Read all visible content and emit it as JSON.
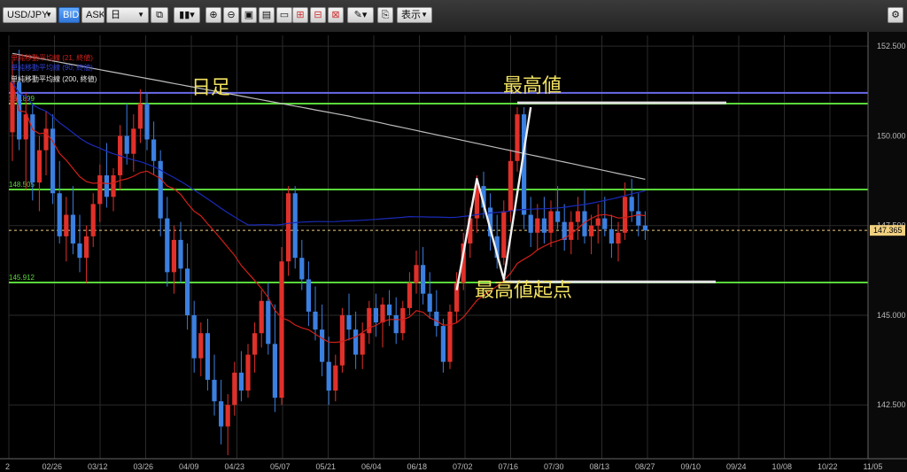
{
  "toolbar": {
    "symbol": "USD/JPY",
    "bid_label": "BID",
    "ask_label": "ASK",
    "timeframe": "日",
    "display_label": "表示"
  },
  "legend": {
    "ma21": "単純移動平均線 (21, 終値)",
    "ma90": "単純移動平均線 (90, 終値)",
    "ma200": "単純移動平均線 (200, 終値)"
  },
  "annotations": {
    "timeframe_note": "日足",
    "high_label": "最高値",
    "high_start_label": "最高値起点"
  },
  "colors": {
    "up": "#e0302a",
    "down": "#3b7fe0",
    "ma21": "#d0201a",
    "ma90": "#1a2ab8",
    "ma200": "#bdbdbd",
    "support": "#5ad83a",
    "resistance_blue": "#6a6ae8",
    "annotation_text": "#f0e060",
    "current_price_tag": "#f0d080"
  },
  "chart_data": {
    "type": "candlestick",
    "symbol": "USD/JPY",
    "timeframe": "daily",
    "ylim": [
      141.0,
      152.8
    ],
    "y_ticks": [
      "152.500",
      "150.000",
      "147.500",
      "145.000",
      "142.500"
    ],
    "x_ticks": [
      "2",
      "02/26",
      "03/12",
      "03/26",
      "04/09",
      "04/23",
      "05/07",
      "05/21",
      "06/04",
      "06/18",
      "07/02",
      "07/16",
      "07/30",
      "08/13",
      "08/27",
      "09/10",
      "09/24",
      "10/08",
      "10/22",
      "11/05"
    ],
    "current_price": "147.365",
    "horizontal_lines": [
      {
        "value": 150.899,
        "label": "150.899",
        "color": "#5ad83a"
      },
      {
        "value": 148.505,
        "label": "148.505",
        "color": "#5ad83a"
      },
      {
        "value": 145.912,
        "label": "145.912",
        "color": "#5ad83a"
      },
      {
        "value": 151.2,
        "label": "",
        "color": "#6a6ae8"
      }
    ],
    "candles": [
      [
        150.1,
        152.1,
        149.3,
        151.5
      ],
      [
        151.5,
        152.4,
        149.6,
        149.9
      ],
      [
        149.9,
        151.2,
        148.5,
        150.6
      ],
      [
        150.6,
        150.9,
        148.2,
        148.7
      ],
      [
        148.7,
        150.0,
        147.9,
        149.6
      ],
      [
        149.6,
        150.7,
        148.9,
        150.2
      ],
      [
        150.2,
        150.6,
        148.1,
        148.4
      ],
      [
        148.4,
        149.3,
        147.0,
        147.2
      ],
      [
        147.2,
        148.3,
        146.5,
        147.8
      ],
      [
        147.8,
        148.6,
        146.7,
        147.0
      ],
      [
        147.0,
        147.8,
        146.2,
        146.6
      ],
      [
        146.6,
        147.5,
        145.9,
        147.2
      ],
      [
        147.2,
        148.4,
        146.9,
        148.1
      ],
      [
        148.1,
        149.2,
        147.6,
        148.9
      ],
      [
        148.9,
        149.8,
        148.0,
        148.3
      ],
      [
        148.3,
        149.1,
        147.9,
        148.9
      ],
      [
        148.9,
        150.3,
        148.5,
        150.0
      ],
      [
        150.0,
        150.9,
        149.2,
        149.5
      ],
      [
        149.5,
        150.6,
        149.0,
        150.2
      ],
      [
        150.2,
        151.3,
        149.8,
        150.9
      ],
      [
        150.9,
        151.2,
        149.6,
        149.9
      ],
      [
        149.9,
        150.4,
        148.9,
        149.3
      ],
      [
        149.3,
        149.6,
        147.2,
        147.7
      ],
      [
        147.7,
        148.3,
        145.8,
        146.2
      ],
      [
        146.2,
        147.5,
        145.6,
        147.1
      ],
      [
        147.1,
        147.6,
        145.9,
        146.3
      ],
      [
        146.3,
        147.0,
        144.6,
        145.0
      ],
      [
        145.0,
        145.4,
        143.4,
        143.8
      ],
      [
        143.8,
        144.8,
        143.3,
        144.5
      ],
      [
        144.5,
        144.9,
        142.9,
        143.2
      ],
      [
        143.2,
        143.9,
        142.2,
        142.6
      ],
      [
        142.6,
        143.2,
        141.4,
        141.9
      ],
      [
        141.9,
        142.8,
        141.1,
        142.5
      ],
      [
        142.5,
        143.7,
        142.2,
        143.4
      ],
      [
        143.4,
        144.0,
        142.6,
        142.9
      ],
      [
        142.9,
        144.2,
        142.7,
        143.9
      ],
      [
        143.9,
        144.8,
        143.4,
        144.5
      ],
      [
        144.5,
        145.7,
        144.1,
        145.4
      ],
      [
        145.4,
        145.9,
        143.9,
        144.2
      ],
      [
        144.2,
        145.3,
        142.3,
        142.7
      ],
      [
        142.7,
        146.9,
        142.5,
        146.5
      ],
      [
        146.5,
        148.6,
        146.1,
        148.4
      ],
      [
        148.4,
        148.6,
        146.3,
        146.6
      ],
      [
        146.6,
        147.1,
        145.7,
        146.0
      ],
      [
        146.0,
        146.5,
        144.7,
        145.1
      ],
      [
        145.1,
        145.8,
        144.3,
        144.6
      ],
      [
        144.6,
        145.3,
        143.3,
        143.7
      ],
      [
        143.7,
        144.4,
        142.5,
        142.9
      ],
      [
        142.9,
        143.9,
        142.6,
        143.6
      ],
      [
        143.6,
        145.2,
        143.4,
        145.0
      ],
      [
        145.0,
        145.6,
        144.3,
        144.6
      ],
      [
        144.6,
        145.1,
        143.5,
        143.9
      ],
      [
        143.9,
        144.8,
        143.5,
        144.5
      ],
      [
        144.5,
        145.4,
        144.2,
        145.2
      ],
      [
        145.2,
        145.6,
        144.4,
        144.8
      ],
      [
        144.8,
        145.5,
        144.1,
        145.3
      ],
      [
        145.3,
        145.7,
        144.7,
        145.0
      ],
      [
        145.0,
        145.5,
        144.2,
        144.5
      ],
      [
        144.5,
        145.4,
        144.3,
        145.2
      ],
      [
        145.2,
        146.2,
        145.0,
        145.9
      ],
      [
        145.9,
        146.8,
        145.6,
        146.4
      ],
      [
        146.4,
        146.9,
        145.3,
        145.6
      ],
      [
        145.6,
        146.2,
        144.9,
        145.1
      ],
      [
        145.1,
        145.7,
        144.4,
        144.7
      ],
      [
        144.7,
        144.9,
        143.4,
        143.7
      ],
      [
        143.7,
        145.3,
        143.5,
        145.1
      ],
      [
        145.1,
        146.2,
        144.8,
        145.9
      ],
      [
        145.9,
        147.3,
        145.7,
        147.0
      ],
      [
        147.0,
        148.0,
        146.6,
        147.7
      ],
      [
        147.7,
        148.9,
        147.3,
        148.6
      ],
      [
        148.6,
        149.0,
        147.7,
        148.0
      ],
      [
        148.0,
        148.4,
        146.8,
        147.2
      ],
      [
        147.2,
        147.8,
        146.3,
        146.6
      ],
      [
        146.6,
        148.2,
        146.4,
        147.9
      ],
      [
        147.9,
        149.6,
        147.6,
        149.3
      ],
      [
        149.3,
        150.8,
        149.0,
        150.6
      ],
      [
        150.6,
        150.8,
        147.4,
        147.8
      ],
      [
        147.8,
        148.3,
        146.9,
        147.3
      ],
      [
        147.3,
        148.1,
        146.8,
        147.7
      ],
      [
        147.7,
        148.3,
        147.0,
        147.3
      ],
      [
        147.3,
        148.2,
        146.9,
        147.9
      ],
      [
        147.9,
        148.6,
        147.4,
        147.6
      ],
      [
        147.6,
        148.1,
        146.8,
        147.1
      ],
      [
        147.1,
        147.9,
        146.7,
        147.6
      ],
      [
        147.6,
        148.3,
        147.1,
        147.9
      ],
      [
        147.9,
        148.5,
        147.0,
        147.2
      ],
      [
        147.2,
        147.8,
        146.7,
        147.5
      ],
      [
        147.5,
        148.1,
        147.0,
        147.7
      ],
      [
        147.7,
        148.3,
        147.2,
        147.4
      ],
      [
        147.4,
        147.8,
        146.6,
        147.0
      ],
      [
        147.0,
        147.6,
        146.5,
        147.3
      ],
      [
        147.3,
        148.7,
        147.1,
        148.3
      ],
      [
        148.3,
        148.8,
        147.6,
        147.9
      ],
      [
        147.9,
        148.4,
        147.2,
        147.5
      ],
      [
        147.5,
        147.9,
        147.1,
        147.365
      ]
    ]
  }
}
